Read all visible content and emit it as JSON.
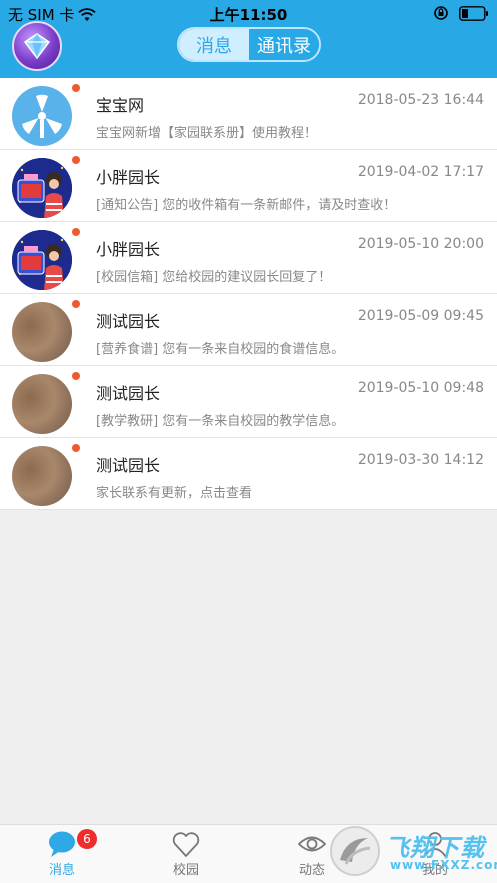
{
  "status_bar": {
    "carrier": "无 SIM 卡",
    "time": "上午11:50"
  },
  "header": {
    "segments": [
      {
        "label": "消息",
        "active": true
      },
      {
        "label": "通讯录",
        "active": false
      }
    ]
  },
  "messages": [
    {
      "name": "宝宝网",
      "time": "2018-05-23 16:44",
      "preview": "宝宝网新增【家园联系册】使用教程！",
      "avatar": "fan-icon",
      "unread": true
    },
    {
      "name": "小胖园长",
      "time": "2019-04-02 17:17",
      "preview": "[通知公告] 您的收件箱有一条新邮件，请及时查收！",
      "avatar": "principal-avatar",
      "unread": true
    },
    {
      "name": "小胖园长",
      "time": "2019-05-10 20:00",
      "preview": "[校园信箱] 您给校园的建议园长回复了！",
      "avatar": "principal-avatar",
      "unread": true
    },
    {
      "name": "测试园长",
      "time": "2019-05-09 09:45",
      "preview": "[营养食谱] 您有一条来自校园的食谱信息。",
      "avatar": "photo-avatar",
      "unread": true
    },
    {
      "name": "测试园长",
      "time": "2019-05-10 09:48",
      "preview": "[教学教研] 您有一条来自校园的教学信息。",
      "avatar": "photo-avatar",
      "unread": true
    },
    {
      "name": "测试园长",
      "time": "2019-03-30 14:12",
      "preview": "家长联系有更新，点击查看",
      "avatar": "photo-avatar",
      "unread": true
    }
  ],
  "tabbar": {
    "tabs": [
      {
        "label": "消息",
        "icon": "chat-bubble-icon",
        "active": true,
        "badge": "6"
      },
      {
        "label": "校园",
        "icon": "heart-icon",
        "active": false
      },
      {
        "label": "动态",
        "icon": "eye-icon",
        "active": false
      },
      {
        "label": "我的",
        "icon": "person-icon",
        "active": false
      }
    ]
  },
  "watermark": {
    "main": "飞翔下载",
    "sub": "www.FXXZ.com"
  },
  "colors": {
    "accent": "#29a8e6",
    "unread_dot": "#f0582f",
    "badge": "#f02d2d"
  }
}
